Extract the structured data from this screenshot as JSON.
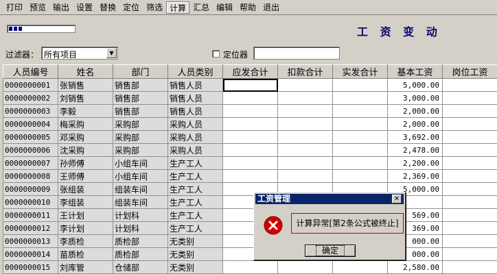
{
  "menu": [
    "打印",
    "预览",
    "输出",
    "设置",
    "替换",
    "定位",
    "筛选",
    "计算",
    "汇总",
    "编辑",
    "帮助",
    "退出"
  ],
  "menu_active_index": 7,
  "progress_percent": 20,
  "title": "工 资 变 动",
  "filter": {
    "label": "过滤器：",
    "value": "所有项目"
  },
  "locator": {
    "label": "定位器",
    "checked": false,
    "value": ""
  },
  "grid": {
    "columns": [
      "人员编号",
      "姓名",
      "部门",
      "人员类别",
      "应发合计",
      "扣款合计",
      "实发合计",
      "基本工资",
      "岗位工资"
    ],
    "rows": [
      [
        "0000000001",
        "张销售",
        "销售部",
        "销售人员",
        "",
        "",
        "",
        "5,000.00",
        ""
      ],
      [
        "0000000002",
        "刘销售",
        "销售部",
        "销售人员",
        "",
        "",
        "",
        "3,000.00",
        ""
      ],
      [
        "0000000003",
        "李毅",
        "销售部",
        "销售人员",
        "",
        "",
        "",
        "2,000.00",
        ""
      ],
      [
        "0000000004",
        "梅采购",
        "采购部",
        "采购人员",
        "",
        "",
        "",
        "2,000.00",
        ""
      ],
      [
        "0000000005",
        "邓采购",
        "采购部",
        "采购人员",
        "",
        "",
        "",
        "3,692.00",
        ""
      ],
      [
        "0000000006",
        "沈采购",
        "采购部",
        "采购人员",
        "",
        "",
        "",
        "2,478.00",
        ""
      ],
      [
        "0000000007",
        "孙师傅",
        "小组车间",
        "生产工人",
        "",
        "",
        "",
        "2,200.00",
        ""
      ],
      [
        "0000000008",
        "王师傅",
        "小组车间",
        "生产工人",
        "",
        "",
        "",
        "2,369.00",
        ""
      ],
      [
        "0000000009",
        "张组装",
        "组装车间",
        "生产工人",
        "",
        "",
        "",
        "5,000.00",
        ""
      ],
      [
        "0000000010",
        "李组装",
        "组装车间",
        "生产工人",
        "",
        "",
        "",
        "",
        ""
      ],
      [
        "0000000011",
        "王计划",
        "计划科",
        "生产工人",
        "",
        "",
        "",
        "569.00",
        ""
      ],
      [
        "0000000012",
        "李计划",
        "计划科",
        "生产工人",
        "",
        "",
        "",
        "369.00",
        ""
      ],
      [
        "0000000013",
        "李质检",
        "质检部",
        "无类别",
        "",
        "",
        "",
        "000.00",
        ""
      ],
      [
        "0000000014",
        "苗质检",
        "质检部",
        "无类别",
        "",
        "",
        "",
        "000.00",
        ""
      ],
      [
        "0000000015",
        "刘库管",
        "仓储部",
        "无类别",
        "",
        "",
        "",
        "2,580.00",
        ""
      ]
    ]
  },
  "dialog": {
    "title": "工资管理",
    "close_glyph": "✕",
    "message": "计算异常[第2条公式被终止]",
    "ok_label": "确定",
    "icon": "error-icon"
  },
  "colors": {
    "window_bg": "#d4d0c8",
    "title_text": "#0a0a6e",
    "dialog_titlebar": "#0a246a",
    "error_red": "#d40000",
    "readonly_cell": "#dcdcdc"
  }
}
